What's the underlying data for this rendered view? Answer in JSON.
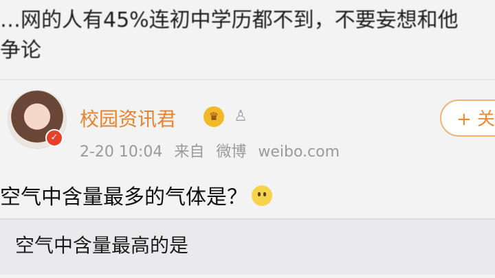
{
  "top_text": {
    "line1": "…网的人有45%连初中学历都不到，不要妄想和他",
    "line2": "争论"
  },
  "post": {
    "username": "校园资讯君",
    "follow_label": "+ 关注",
    "time": "2-20 10:04",
    "source_prefix": "来自",
    "source_app": "微博",
    "source_site": "weibo.com",
    "text": "空气中含量最多的气体是？",
    "quote": "空气中含量最高的是"
  },
  "icons": [
    "vip-crown-icon",
    "level-icon",
    "smile-emoji-icon",
    "verified-badge-icon"
  ]
}
